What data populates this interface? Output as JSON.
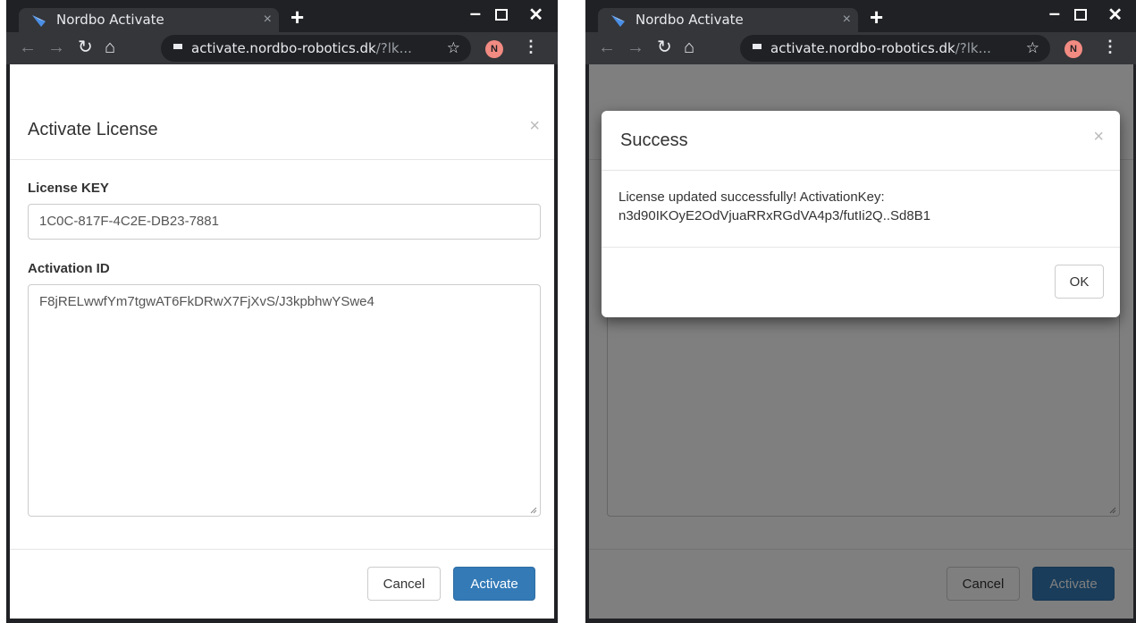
{
  "browser": {
    "tab_title": "Nordbo Activate",
    "tab_close": "×",
    "new_tab": "+",
    "url_host": "activate.nordbo-robotics.dk",
    "url_path": "/?lk...",
    "avatar_initial": "N",
    "window_controls": {
      "minimize": "–",
      "close": "✕"
    },
    "icons": [
      "back-arrow-icon",
      "forward-arrow-icon",
      "reload-icon",
      "home-icon",
      "lock-icon",
      "star-icon",
      "menu-dots-icon"
    ]
  },
  "left": {
    "modal": {
      "title": "Activate License",
      "close": "×",
      "license_key_label": "License KEY",
      "license_key_value": "1C0C-817F-4C2E-DB23-7881",
      "activation_id_label": "Activation ID",
      "activation_id_value": "F8jRELwwfYm7tgwAT6FkDRwX7FjXvS/J3kpbhwYSwe4",
      "cancel_label": "Cancel",
      "activate_label": "Activate"
    }
  },
  "right": {
    "background_modal": {
      "cancel_label": "Cancel",
      "activate_label": "Activate"
    },
    "dialog": {
      "title": "Success",
      "close": "×",
      "message_line1": "License updated successfully! ActivationKey:",
      "message_line2": "n3d90IKOyE2OdVjuaRRxRGdVA4p3/futIi2Q..Sd8B1",
      "ok_label": "OK"
    }
  },
  "colors": {
    "browser_frame": "#202124",
    "tab": "#35363a",
    "primary_button": "#337ab7",
    "avatar": "#f28b82"
  }
}
